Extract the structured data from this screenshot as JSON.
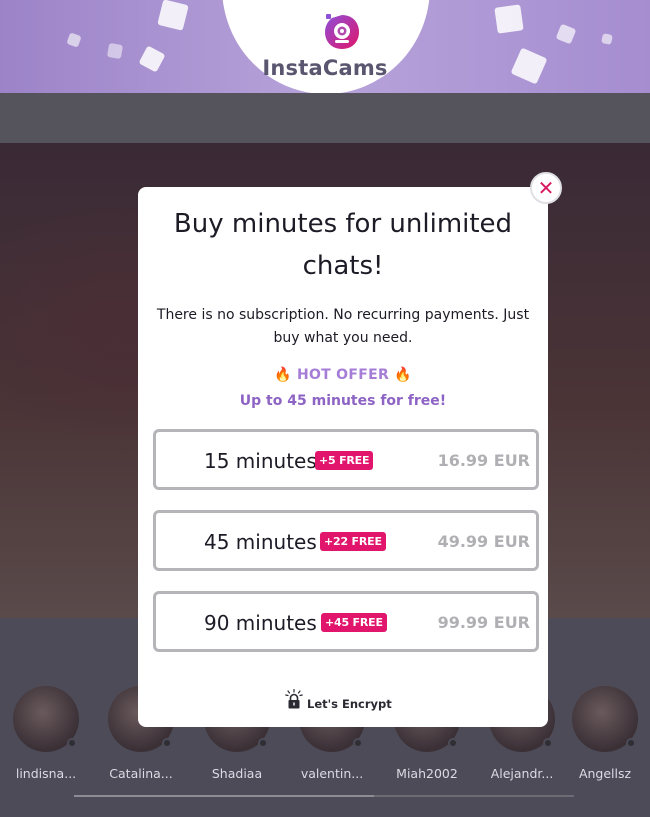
{
  "header": {
    "brand": "InstaCams"
  },
  "modal": {
    "title": "Buy minutes for unlimited chats!",
    "subtitle": "There is no subscription. No recurring payments. Just buy what you need.",
    "hot_offer": {
      "flame": "🔥",
      "label": "HOT OFFER",
      "detail": "Up to 45 minutes for free!"
    },
    "plans": [
      {
        "minutes": "15 minutes",
        "bonus": "+5 FREE",
        "price": "16.99 EUR"
      },
      {
        "minutes": "45 minutes",
        "bonus": "+22 FREE",
        "price": "49.99 EUR"
      },
      {
        "minutes": "90 minutes",
        "bonus": "+45 FREE",
        "price": "99.99 EUR"
      }
    ],
    "security_label": "Let's Encrypt",
    "close_symbol": "✕"
  },
  "performers": [
    {
      "name": "lindisna..."
    },
    {
      "name": "Catalina..."
    },
    {
      "name": "Shadiaa"
    },
    {
      "name": "valentin..."
    },
    {
      "name": "Miah2002"
    },
    {
      "name": "Alejandr..."
    },
    {
      "name": "Angellsz"
    }
  ],
  "colors": {
    "brand_purple": "#a57cd6",
    "badge_pink": "#e0156b",
    "close_pink": "#d81b60"
  }
}
